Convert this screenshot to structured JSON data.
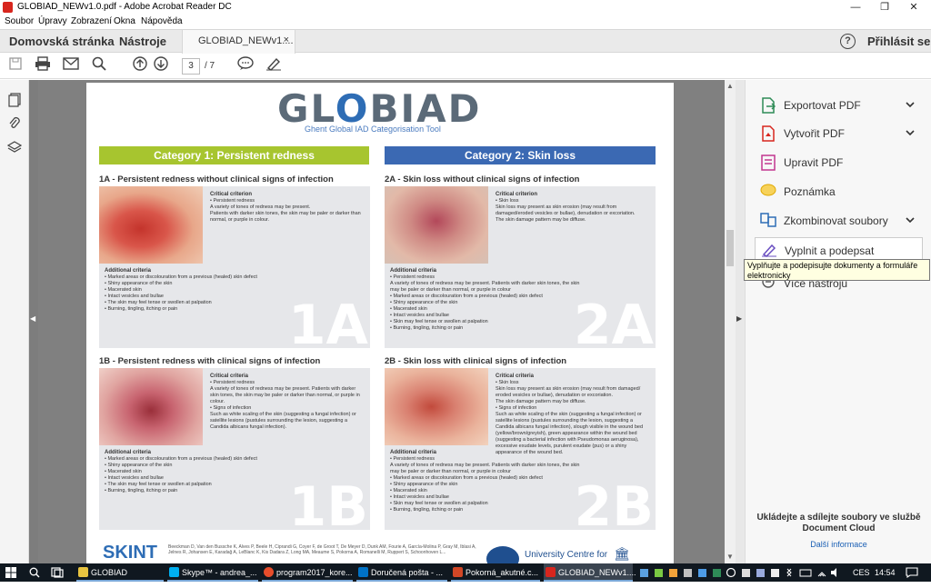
{
  "window": {
    "title": "GLOBIAD_NEWv1.0.pdf - Adobe Acrobat Reader DC",
    "minimize": "—",
    "restore": "❐",
    "close": "✕"
  },
  "menu": [
    "Soubor",
    "Úpravy",
    "Zobrazení",
    "Okna",
    "Nápověda"
  ],
  "tabs": {
    "home": "Domovská stránka",
    "tools": "Nástroje",
    "document": "GLOBIAD_NEWv1....",
    "close": "×",
    "help": "?",
    "signin": "Přihlásit se"
  },
  "toolbar": {
    "page_current": "3",
    "page_total": "/ 7"
  },
  "right_panel": {
    "items": [
      {
        "label": "Exportovat PDF",
        "color": "#2e8b57",
        "icon": "export-pdf-icon",
        "chev": "⌄"
      },
      {
        "label": "Vytvořit PDF",
        "color": "#d7261e",
        "icon": "create-pdf-icon",
        "chev": "⌄"
      },
      {
        "label": "Upravit PDF",
        "color": "#c2378f",
        "icon": "edit-pdf-icon",
        "chev": ""
      },
      {
        "label": "Poznámka",
        "color": "#f0b400",
        "icon": "comment-icon",
        "chev": ""
      },
      {
        "label": "Zkombinovat soubory",
        "color": "#2e6db5",
        "icon": "combine-icon",
        "chev": "⌄"
      },
      {
        "label": "Vyplnit a podepsat",
        "color": "#6a4fc1",
        "icon": "fill-sign-icon",
        "chev": ""
      }
    ],
    "tooltip": "Vyplňujte a podepisujte dokumenty a formuláře elektronicky",
    "hidden_item": "Více nástrojů",
    "footer": "Ukládejte a sdílejte soubory ve službě Document Cloud",
    "more_info": "Další informace"
  },
  "pdf": {
    "logo_a": "GL",
    "logo_o": "O",
    "logo_b": "BIAD",
    "subtitle": "Ghent Global IAD Categorisation Tool",
    "category1": "Category 1: Persistent redness",
    "category2": "Category 2: Skin loss",
    "category1_color": "#a7c52f",
    "category2_color": "#3b69b3",
    "cards": [
      {
        "heading": "1A - Persistent redness without clinical signs of infection",
        "id": "1A",
        "critical_title": "Critical criterion",
        "critical": "• Persistent redness\nA variety of tones of redness may be present.\nPatients with darker skin tones, the skin may be paler or darker than normal, or purple in colour.",
        "additional_title": "Additional criteria",
        "additional": "• Marked areas or discolouration from a previous (healed) skin defect\n• Shiny appearance of the skin\n• Macerated skin\n• Intact vesicles and bullae\n• The skin may feel tense or swollen at palpation\n• Burning, tingling, itching or pain"
      },
      {
        "heading": "2A - Skin loss without clinical signs of infection",
        "id": "2A",
        "critical_title": "Critical criterion",
        "critical": "• Skin loss\nSkin loss may present as skin erosion (may result from damaged/eroded vesicles or bullae), denudation or excoriation.\nThe skin damage pattern may be diffuse.",
        "additional_title": "Additional criteria",
        "additional": "• Persistent redness\nA variety of tones of redness may be present. Patients with darker skin tones, the skin may be paler or darker than normal, or purple in colour\n• Marked areas or discolouration from a previous (healed) skin defect\n• Shiny appearance of the skin\n• Macerated skin\n• Intact vesicles and bullae\n• Skin may feel tense or swollen at palpation\n• Burning, tingling, itching or pain"
      },
      {
        "heading": "1B - Persistent redness with clinical signs of infection",
        "id": "1B",
        "critical_title": "Critical criteria",
        "critical": "• Persistent redness\nA variety of tones of redness may be present. Patients with darker skin tones, the skin may be paler or darker than normal, or purple in colour.\n• Signs of infection\nSuch as white scaling of the skin (suggesting a fungal infection) or satellite lesions (pustules surrounding the lesion, suggesting a Candida albicans fungal infection).",
        "additional_title": "Additional criteria",
        "additional": "• Marked areas or discolouration from a previous (healed) skin defect\n• Shiny appearance of the skin\n• Macerated skin\n• Intact vesicles and bullae\n• The skin may feel tense or swollen at palpation\n• Burning, tingling, itching or pain"
      },
      {
        "heading": "2B - Skin loss with clinical signs of infection",
        "id": "2B",
        "critical_title": "Critical criteria",
        "critical": "• Skin loss\nSkin loss may present as skin erosion (may result from damaged/ eroded vesicles or bullae), denudation or excoriation.\nThe skin damage pattern may be diffuse.\n• Signs of infection\nSuch as white scaling of the skin (suggesting a fungal infection) or satellite lesions (pustules surrounding the lesion, suggesting a Candida albicans fungal infection), slough visible in the wound bed (yellow/brown/greyish), green appearance within the wound bed (suggesting a bacterial infection with Pseudomonas aeruginosa), excessive exudate levels, purulent exudate (pus) or a shiny appearance of the wound bed.",
        "additional_title": "Additional criteria",
        "additional": "• Persistent redness\nA variety of tones of redness may be present. Patients with darker skin tones, the skin may be paler or darker than normal, or purple in colour\n• Marked areas or discolouration from a previous (healed) skin defect\n• Shiny appearance of the skin\n• Macerated skin\n• Intact vesicles and bullae\n• Skin may feel tense or swollen at palpation\n• Burning, tingling, itching or pain"
      }
    ],
    "footer_logo": "SKINT",
    "footer_cite": "Beeckman D, Van den Bussche K, Alves P, Beele H, Ciprandi G, Coyer F, de Groot T, De Meyer D, Dunk AM, Fourie A, García-Molina P, Gray M, Iblasi A, Jelnes R, Johansen E, Karadağ A, LeBlanc K, Kis Dadara Z, Long MA, Meaume S, Pokorna A, Romanelli M, Ruppert S, Schoonhoven L...",
    "footer_uni": "University Centre for"
  },
  "taskbar": {
    "apps": [
      {
        "label": "GLOBIAD",
        "color": "#e8c440"
      },
      {
        "label": "Skype™ - andrea_...",
        "color": "#00aff0"
      },
      {
        "label": "program2017_kore...",
        "color": "#e84d2b"
      },
      {
        "label": "Doručená pošta - ...",
        "color": "#0072c6"
      },
      {
        "label": "Pokorná_akutné.c...",
        "color": "#d24726"
      },
      {
        "label": "GLOBIAD_NEWv1....",
        "color": "#d7261e"
      }
    ],
    "lang": "CES",
    "time": "14:54"
  }
}
